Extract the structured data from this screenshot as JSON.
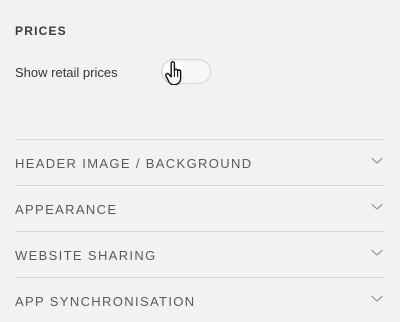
{
  "prices": {
    "title": "PRICES",
    "retail_label": "Show retail prices",
    "retail_enabled": false
  },
  "accordion": {
    "items": [
      {
        "label": "HEADER IMAGE / BACKGROUND",
        "icon": "chevron-down-icon"
      },
      {
        "label": "APPEARANCE",
        "icon": "chevron-down-icon"
      },
      {
        "label": "WEBSITE SHARING",
        "icon": "chevron-down-icon"
      },
      {
        "label": "APP SYNCHRONISATION",
        "icon": "chevron-down-icon"
      }
    ]
  },
  "colors": {
    "background": "#f3f1f3",
    "text": "#3f3b41",
    "divider": "#d7d3d8",
    "toggle_border": "#d8d4da"
  },
  "icons": {
    "cursor": "hand-pointer-icon",
    "chevron": "chevron-down-icon"
  }
}
